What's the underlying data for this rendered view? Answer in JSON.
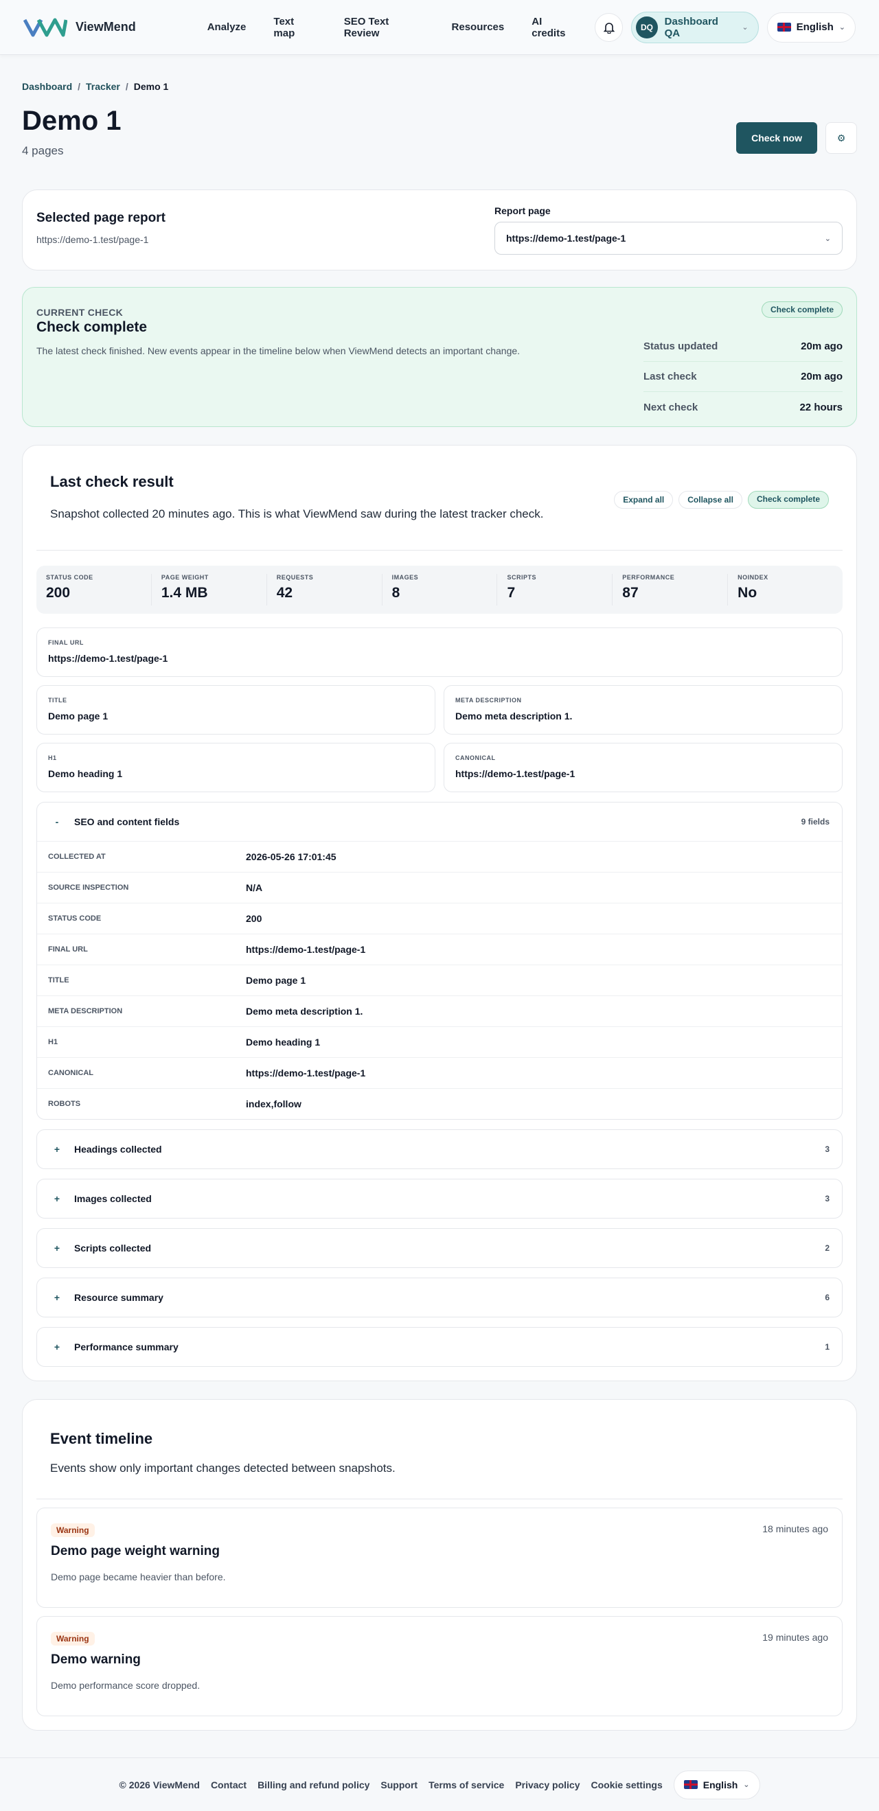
{
  "header": {
    "brand": "ViewMend",
    "nav": [
      "Analyze",
      "Text map",
      "SEO Text Review",
      "Resources",
      "AI credits"
    ],
    "account_initials": "DQ",
    "account_name": "Dashboard QA",
    "language": "English"
  },
  "breadcrumb": [
    "Dashboard",
    "Tracker",
    "Demo 1"
  ],
  "page": {
    "title": "Demo 1",
    "subtitle": "4 pages",
    "check_now_label": "Check now"
  },
  "report": {
    "title": "Selected page report",
    "url": "https://demo-1.test/page-1",
    "select_label": "Report page",
    "select_value": "https://demo-1.test/page-1"
  },
  "current_check": {
    "kicker": "CURRENT CHECK",
    "title": "Check complete",
    "desc": "The latest check finished. New events appear in the timeline below when ViewMend detects an important change.",
    "badge": "Check complete",
    "stats": [
      {
        "k": "Status updated",
        "v": "20m ago"
      },
      {
        "k": "Last check",
        "v": "20m ago"
      },
      {
        "k": "Next check",
        "v": "22 hours"
      }
    ]
  },
  "result": {
    "title": "Last check result",
    "desc": "Snapshot collected 20 minutes ago. This is what ViewMend saw during the latest tracker check.",
    "expand_all": "Expand all",
    "collapse_all": "Collapse all",
    "badge": "Check complete",
    "metrics": [
      {
        "k": "STATUS CODE",
        "v": "200"
      },
      {
        "k": "PAGE WEIGHT",
        "v": "1.4 MB"
      },
      {
        "k": "REQUESTS",
        "v": "42"
      },
      {
        "k": "IMAGES",
        "v": "8"
      },
      {
        "k": "SCRIPTS",
        "v": "7"
      },
      {
        "k": "PERFORMANCE",
        "v": "87"
      },
      {
        "k": "NOINDEX",
        "v": "No"
      }
    ],
    "final_url": {
      "k": "FINAL URL",
      "v": "https://demo-1.test/page-1"
    },
    "title_field": {
      "k": "TITLE",
      "v": "Demo page 1"
    },
    "meta_field": {
      "k": "META DESCRIPTION",
      "v": "Demo meta description 1."
    },
    "h1_field": {
      "k": "H1",
      "v": "Demo heading 1"
    },
    "canonical_field": {
      "k": "CANONICAL",
      "v": "https://demo-1.test/page-1"
    },
    "seo_section": {
      "sign": "-",
      "title": "SEO and content fields",
      "count": "9 fields",
      "rows": [
        {
          "k": "COLLECTED AT",
          "v": "2026-05-26 17:01:45"
        },
        {
          "k": "SOURCE INSPECTION",
          "v": "N/A"
        },
        {
          "k": "STATUS CODE",
          "v": "200"
        },
        {
          "k": "FINAL URL",
          "v": "https://demo-1.test/page-1"
        },
        {
          "k": "TITLE",
          "v": "Demo page 1"
        },
        {
          "k": "META DESCRIPTION",
          "v": "Demo meta description 1."
        },
        {
          "k": "H1",
          "v": "Demo heading 1"
        },
        {
          "k": "CANONICAL",
          "v": "https://demo-1.test/page-1"
        },
        {
          "k": "ROBOTS",
          "v": "index,follow"
        }
      ]
    },
    "sections": [
      {
        "sign": "+",
        "title": "Headings collected",
        "count": "3"
      },
      {
        "sign": "+",
        "title": "Images collected",
        "count": "3"
      },
      {
        "sign": "+",
        "title": "Scripts collected",
        "count": "2"
      },
      {
        "sign": "+",
        "title": "Resource summary",
        "count": "6"
      },
      {
        "sign": "+",
        "title": "Performance summary",
        "count": "1"
      }
    ]
  },
  "timeline": {
    "title": "Event timeline",
    "desc": "Events show only important changes detected between snapshots.",
    "events": [
      {
        "badge": "Warning",
        "title": "Demo page weight warning",
        "desc": "Demo page became heavier than before.",
        "time": "18 minutes ago"
      },
      {
        "badge": "Warning",
        "title": "Demo warning",
        "desc": "Demo performance score dropped.",
        "time": "19 minutes ago"
      }
    ]
  },
  "footer": {
    "links": [
      "© 2026 ViewMend",
      "Contact",
      "Billing and refund policy",
      "Support",
      "Terms of service",
      "Privacy policy",
      "Cookie settings"
    ],
    "language": "English"
  },
  "colors": {
    "accent": "#1f5560",
    "success_bg": "#eaf8f1",
    "warning_bg": "#fff1e6"
  }
}
